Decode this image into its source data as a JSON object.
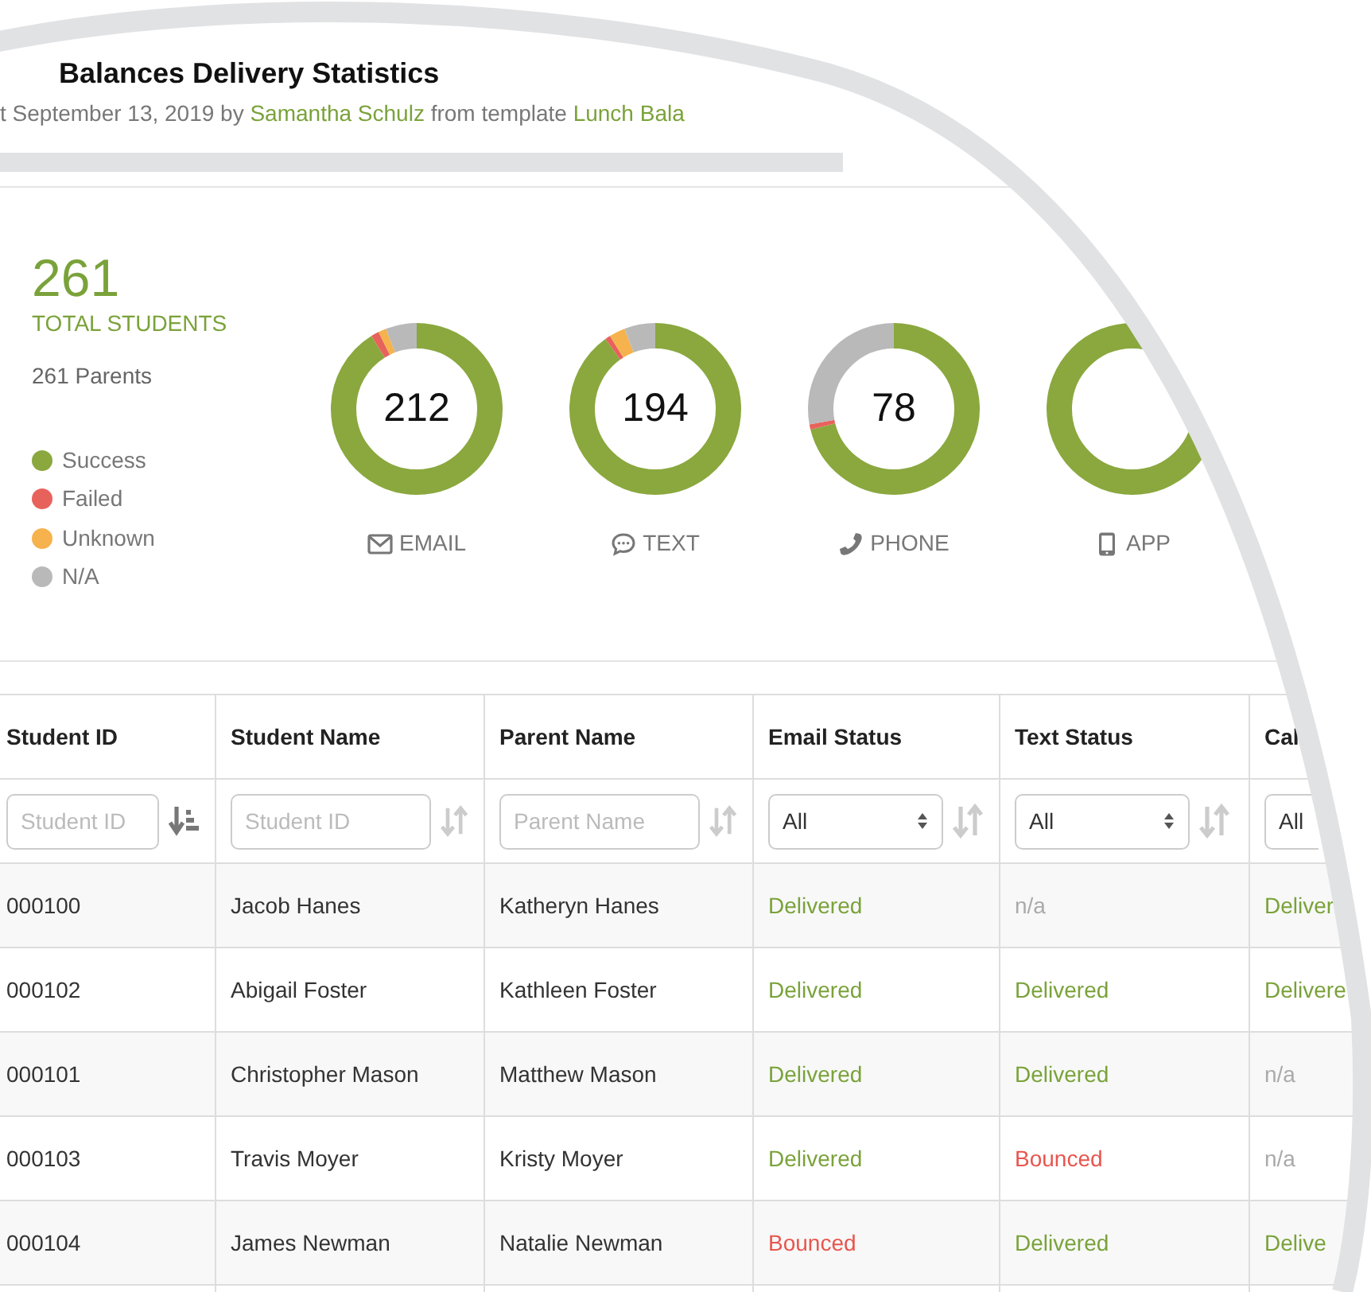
{
  "report": {
    "title": "Balances Delivery Statistics",
    "byline": "t September 13, 2019 by",
    "author": "Samantha Schulz",
    "template_prefix": "from template",
    "template": "Lunch Bala"
  },
  "summary": {
    "total": "261",
    "total_label": "TOTAL STUDENTS",
    "parents": "261 Parents",
    "legend": [
      {
        "label": "Success",
        "color": "#8aa83e"
      },
      {
        "label": "Failed",
        "color": "#e8625c"
      },
      {
        "label": "Unknown",
        "color": "#f6b24c"
      },
      {
        "label": "N/A",
        "color": "#b9b9b9"
      }
    ]
  },
  "channels": [
    {
      "kind": "email",
      "count": "212",
      "label": "EMAIL"
    },
    {
      "kind": "text",
      "count": "194",
      "label": "TEXT"
    },
    {
      "kind": "phone",
      "count": "78",
      "label": "PHONE"
    },
    {
      "kind": "app",
      "label": "APP"
    }
  ],
  "table": {
    "columns": [
      "Student ID",
      "Student Name",
      "Parent Name",
      "Email Status",
      "Text Status",
      "Cal"
    ],
    "filters": [
      {
        "kind": "text",
        "placeholder": "Student ID",
        "sorted": true
      },
      {
        "kind": "text",
        "placeholder": "Student ID",
        "sorted": false
      },
      {
        "kind": "text",
        "placeholder": "Parent Name",
        "sorted": false
      },
      {
        "kind": "select",
        "value": "All",
        "sorted": false
      },
      {
        "kind": "select",
        "value": "All",
        "sorted": false
      },
      {
        "kind": "select",
        "value": "All"
      }
    ],
    "rows": [
      {
        "id": "000100",
        "student": "Jacob Hanes",
        "parent": "Katheryn Hanes",
        "statuses": [
          {
            "text": "Delivered",
            "color": "#7aa23a"
          },
          {
            "text": "n/a",
            "color": "#aaaaaa"
          },
          {
            "text": "Deliver",
            "color": "#7aa23a"
          }
        ]
      },
      {
        "id": "000102",
        "student": "Abigail Foster",
        "parent": "Kathleen Foster",
        "statuses": [
          {
            "text": "Delivered",
            "color": "#7aa23a"
          },
          {
            "text": "Delivered",
            "color": "#7aa23a"
          },
          {
            "text": "Delivere",
            "color": "#7aa23a"
          }
        ]
      },
      {
        "id": "000101",
        "student": "Christopher Mason",
        "parent": "Matthew Mason",
        "statuses": [
          {
            "text": "Delivered",
            "color": "#7aa23a"
          },
          {
            "text": "Delivered",
            "color": "#7aa23a"
          },
          {
            "text": "n/a",
            "color": "#aaaaaa"
          }
        ]
      },
      {
        "id": "000103",
        "student": "Travis Moyer",
        "parent": "Kristy Moyer",
        "statuses": [
          {
            "text": "Delivered",
            "color": "#7aa23a"
          },
          {
            "text": "Bounced",
            "color": "#e8554e"
          },
          {
            "text": "n/a",
            "color": "#aaaaaa"
          }
        ]
      },
      {
        "id": "000104",
        "student": "James Newman",
        "parent": "Natalie Newman",
        "statuses": [
          {
            "text": "Bounced",
            "color": "#e8554e"
          },
          {
            "text": "Delivered",
            "color": "#7aa23a"
          },
          {
            "text": "Delive",
            "color": "#7aa23a"
          }
        ]
      }
    ]
  }
}
